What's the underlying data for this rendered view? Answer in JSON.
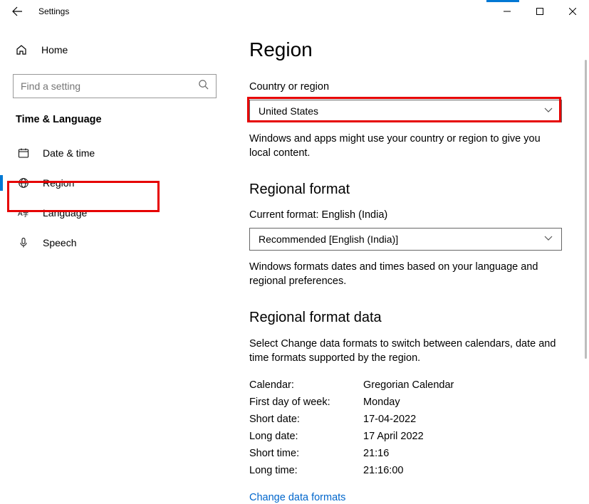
{
  "titlebar": {
    "title": "Settings"
  },
  "sidebar": {
    "home_label": "Home",
    "search_placeholder": "Find a setting",
    "section_title": "Time & Language",
    "items": [
      {
        "label": "Date & time"
      },
      {
        "label": "Region"
      },
      {
        "label": "Language"
      },
      {
        "label": "Speech"
      }
    ]
  },
  "main": {
    "page_title": "Region",
    "country_label": "Country or region",
    "country_value": "United States",
    "country_help": "Windows and apps might use your country or region to give you local content.",
    "regional_format_heading": "Regional format",
    "current_format_label": "Current format: English (India)",
    "format_dropdown_value": "Recommended [English (India)]",
    "format_help": "Windows formats dates and times based on your language and regional preferences.",
    "format_data_heading": "Regional format data",
    "format_data_help": "Select Change data formats to switch between calendars, date and time formats supported by the region.",
    "rows": [
      {
        "k": "Calendar:",
        "v": "Gregorian Calendar"
      },
      {
        "k": "First day of week:",
        "v": "Monday"
      },
      {
        "k": "Short date:",
        "v": "17-04-2022"
      },
      {
        "k": "Long date:",
        "v": "17 April 2022"
      },
      {
        "k": "Short time:",
        "v": "21:16"
      },
      {
        "k": "Long time:",
        "v": "21:16:00"
      }
    ],
    "change_link": "Change data formats"
  }
}
